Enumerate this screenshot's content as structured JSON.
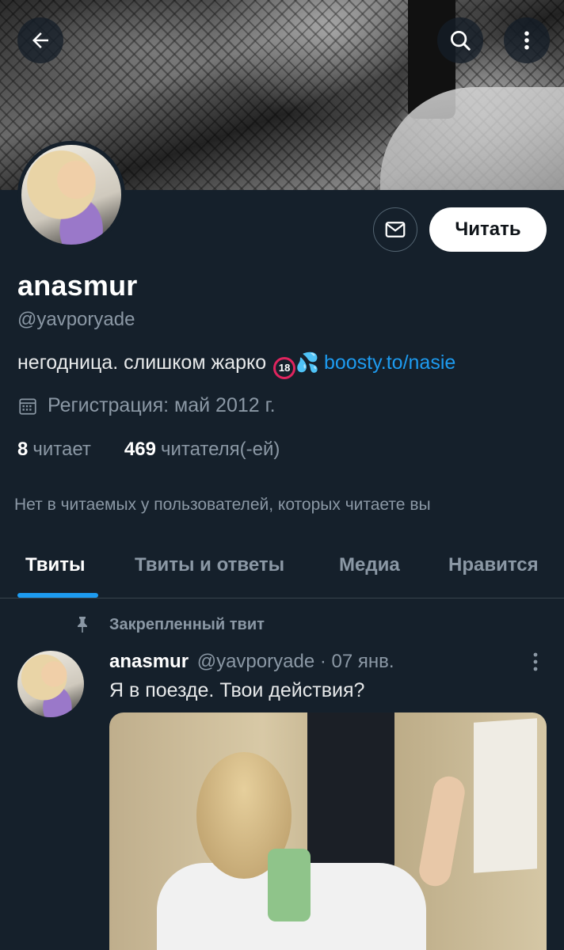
{
  "profile": {
    "name": "anasmur",
    "handle": "@yavporyade",
    "bio_text": "негодница. слишком жарко",
    "bio_emoji_18": "18",
    "bio_link": "boosty.to/nasie",
    "joined": "Регистрация: май 2012 г.",
    "following_count": "8",
    "following_label": "читает",
    "followers_count": "469",
    "followers_label": "читателя(-ей)",
    "mutual_note": "Нет в читаемых у пользователей, которых читаете вы"
  },
  "actions": {
    "follow_label": "Читать"
  },
  "tabs": [
    {
      "label": "Твиты",
      "active": true
    },
    {
      "label": "Твиты и ответы",
      "active": false
    },
    {
      "label": "Медиа",
      "active": false
    },
    {
      "label": "Нравится",
      "active": false
    }
  ],
  "pinned_tweet": {
    "pinned_label": "Закрепленный твит",
    "author_name": "anasmur",
    "author_handle": "@yavporyade",
    "date": "· 07 янв.",
    "text": "Я в поезде. Твои действия?"
  },
  "colors": {
    "background": "#15202b",
    "accent": "#1d9bf0",
    "muted": "#8b98a5"
  }
}
